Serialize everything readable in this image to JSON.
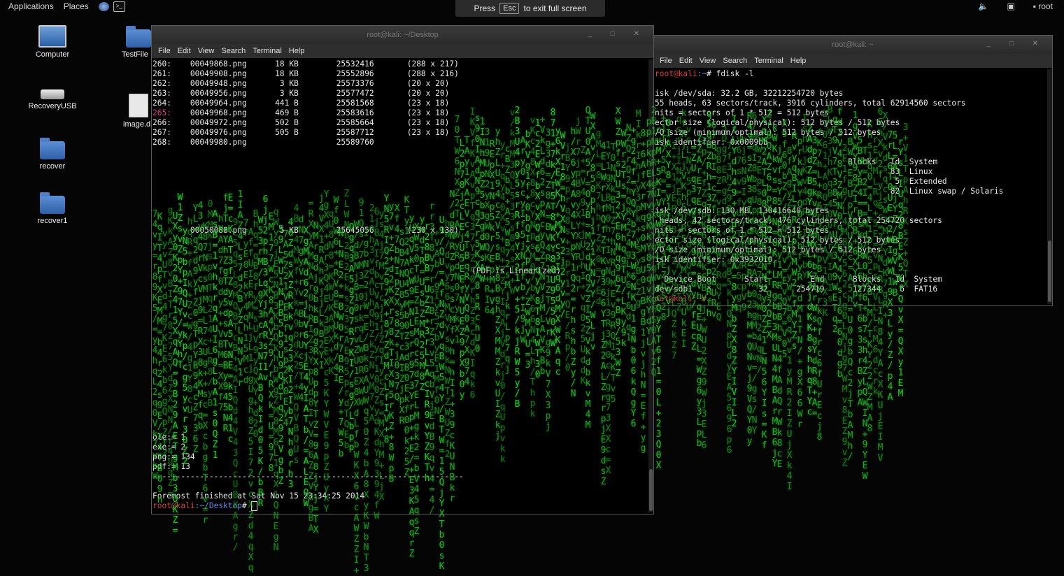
{
  "topbar": {
    "applications": "Applications",
    "places": "Places",
    "user": "root"
  },
  "fullscreen_notice": {
    "before": "Press",
    "key": "Esc",
    "after": "to exit full screen"
  },
  "desktop_icons": [
    {
      "label": "Computer",
      "icon": "computer-icon"
    },
    {
      "label": "TestFile",
      "icon": "folder-icon"
    },
    {
      "label": "RecoveryUSB",
      "icon": "drive-icon"
    },
    {
      "label": "image.d",
      "icon": "document-icon"
    },
    {
      "label": "recover",
      "icon": "folder-icon"
    },
    {
      "label": "recover1",
      "icon": "folder-icon"
    }
  ],
  "terminal_left": {
    "title": "root@kali: ~/Desktop",
    "menu": [
      "File",
      "Edit",
      "View",
      "Search",
      "Terminal",
      "Help"
    ],
    "rows": [
      [
        "260:",
        "00049868.png",
        "18 KB",
        "25532416",
        "(288 x 217)"
      ],
      [
        "261:",
        "00049908.png",
        "18 KB",
        "25552896",
        "(288 x 216)"
      ],
      [
        "262:",
        "00049948.png",
        "3 KB",
        "25573376",
        "(20 x 20)"
      ],
      [
        "263:",
        "00049956.png",
        "3 KB",
        "25577472",
        "(20 x 20)"
      ],
      [
        "264:",
        "00049964.png",
        "441 B",
        "25581568",
        "(23 x 18)"
      ],
      [
        "265:",
        "00049968.png",
        "469 B",
        "25583616",
        "(23 x 18)"
      ],
      [
        "266:",
        "00049972.png",
        "502 B",
        "25585664",
        "(23 x 18)"
      ],
      [
        "267:",
        "00049976.png",
        "505 B",
        "25587712",
        "(23 x 18)"
      ],
      [
        "268:",
        "00049980.png",
        "",
        "25589760",
        ""
      ],
      [
        "",
        "",
        "",
        "",
        ""
      ],
      [
        "",
        "",
        "",
        "",
        ""
      ],
      [
        "",
        "",
        "",
        "",
        ""
      ],
      [
        "",
        "",
        "",
        "",
        ""
      ],
      [
        "",
        "",
        "",
        "",
        ""
      ],
      [
        "",
        "",
        "",
        "",
        ""
      ],
      [
        "",
        "",
        "",
        "",
        ""
      ],
      [
        "",
        "",
        "",
        "",
        ""
      ],
      [
        "",
        "00050088.png",
        "5 KB",
        "25645056",
        "(230 x 130)"
      ]
    ],
    "linearized": "(PDF is Linearized)",
    "summary": [
      "ole:= 1",
      "exe:= 2",
      "png:= 134",
      "pdf:= 13"
    ],
    "separator": "------------------------------------------------------------------",
    "finished": "Foremost finished at Sat Nov 15 23:34:25 2014",
    "prompt_user": "root@kali",
    "prompt_path": ":~/Desktop",
    "prompt_hash": "#"
  },
  "terminal_right": {
    "title": "root@kali: ~",
    "menu": [
      "File",
      "Edit",
      "View",
      "Search",
      "Terminal",
      "Help"
    ],
    "prompt_user": "root@kali",
    "prompt_path": ":~",
    "command": "# fdisk -l",
    "lines": [
      "",
      "isk /dev/sda: 32.2 GB, 32212254720 bytes",
      "55 heads, 63 sectors/track, 3916 cylinders, total 62914560 sectors",
      "nits = sectors of 1 * 512 = 512 bytes",
      "ector size (logical/physical): 512 bytes / 512 bytes",
      "/O size (minimum/optimal): 512 bytes / 512 bytes",
      "isk identifier: 0x0009bb",
      "",
      "                                         Blocks   Id  System",
      "                                                  83  Linux",
      "                                                   5  Extended",
      "                                                  82  Linux swap / Solaris",
      "",
      "isk /dev/sdb: 130 MB, 130416640 bytes",
      " heads, 42 sectors/track, 476 cylinders, total 254720 sectors",
      "nits = sectors of 1 * 512 = 512 bytes",
      "ector size (logical/physical): 512 bytes / 512 bytes",
      "/O size (minimum/optimal): 512 bytes / 512 bytes",
      "isk identifier: 0x3932010",
      "",
      "  Device Boot      Start         End      Blocks   Id  System",
      "dev/sdb1   *          32      254719      127344    6  FAT16",
      "oot@kali:~#"
    ]
  },
  "matrix": {
    "glyphs": "AZ0=B7XqWR4dK1fMZc9vT2y+pL8sQ/hN3gE5jU6rYbVkI",
    "color": "#2fd23a"
  },
  "colors": {
    "background": "#050505",
    "prompt_user": "#e03a3a",
    "prompt_path": "#5f8ce8",
    "matrix_green": "#2fd23a"
  }
}
